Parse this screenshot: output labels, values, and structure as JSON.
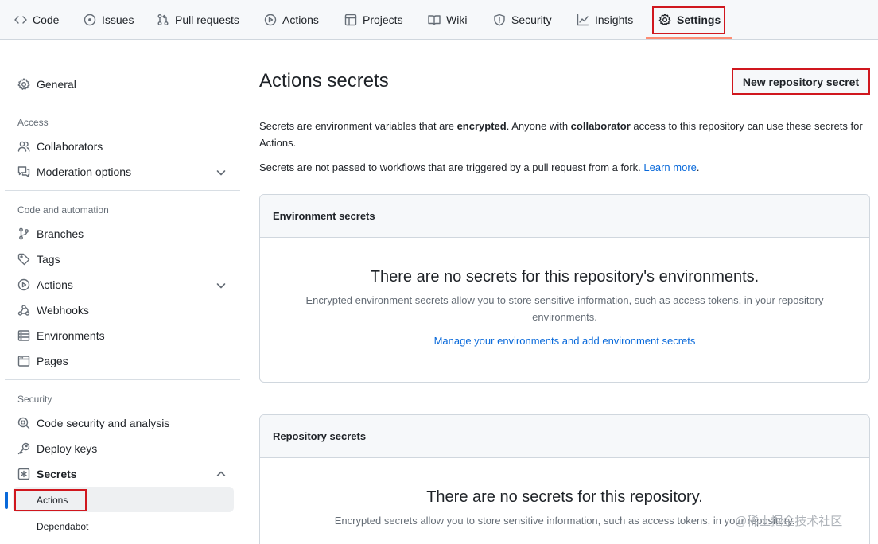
{
  "nav": {
    "tabs": [
      {
        "label": "Code",
        "icon": "code-icon"
      },
      {
        "label": "Issues",
        "icon": "issue-icon"
      },
      {
        "label": "Pull requests",
        "icon": "pull-request-icon"
      },
      {
        "label": "Actions",
        "icon": "play-icon"
      },
      {
        "label": "Projects",
        "icon": "table-icon"
      },
      {
        "label": "Wiki",
        "icon": "book-icon"
      },
      {
        "label": "Security",
        "icon": "shield-icon"
      },
      {
        "label": "Insights",
        "icon": "graph-icon"
      },
      {
        "label": "Settings",
        "icon": "gear-icon",
        "selected": true
      }
    ]
  },
  "sidebar": {
    "general": "General",
    "access_heading": "Access",
    "collaborators": "Collaborators",
    "moderation": "Moderation options",
    "code_heading": "Code and automation",
    "branches": "Branches",
    "tags": "Tags",
    "actions": "Actions",
    "webhooks": "Webhooks",
    "environments": "Environments",
    "pages": "Pages",
    "security_heading": "Security",
    "code_security": "Code security and analysis",
    "deploy_keys": "Deploy keys",
    "secrets": "Secrets",
    "secrets_actions": "Actions",
    "secrets_dependabot": "Dependabot"
  },
  "main": {
    "title": "Actions secrets",
    "new_secret_button": "New repository secret",
    "desc1_a": "Secrets are environment variables that are ",
    "desc1_b": "encrypted",
    "desc1_c": ". Anyone with ",
    "desc1_d": "collaborator",
    "desc1_e": " access to this repository can use these secrets for Actions.",
    "desc2": "Secrets are not passed to workflows that are triggered by a pull request from a fork. ",
    "learn_more": "Learn more",
    "desc2_end": ".",
    "env_box": {
      "header": "Environment secrets",
      "blank_title": "There are no secrets for this repository's environments.",
      "blank_desc": "Encrypted environment secrets allow you to store sensitive information, such as access tokens, in your repository environments.",
      "link": "Manage your environments and add environment secrets"
    },
    "repo_box": {
      "header": "Repository secrets",
      "blank_title": "There are no secrets for this repository.",
      "blank_desc": "Encrypted secrets allow you to store sensitive information, such as access tokens, in your repository."
    }
  },
  "watermark": "@稀土掘金技术社区",
  "colors": {
    "accent": "#0969da",
    "highlight_box": "#d0171e",
    "underline": "#fd8c73"
  }
}
